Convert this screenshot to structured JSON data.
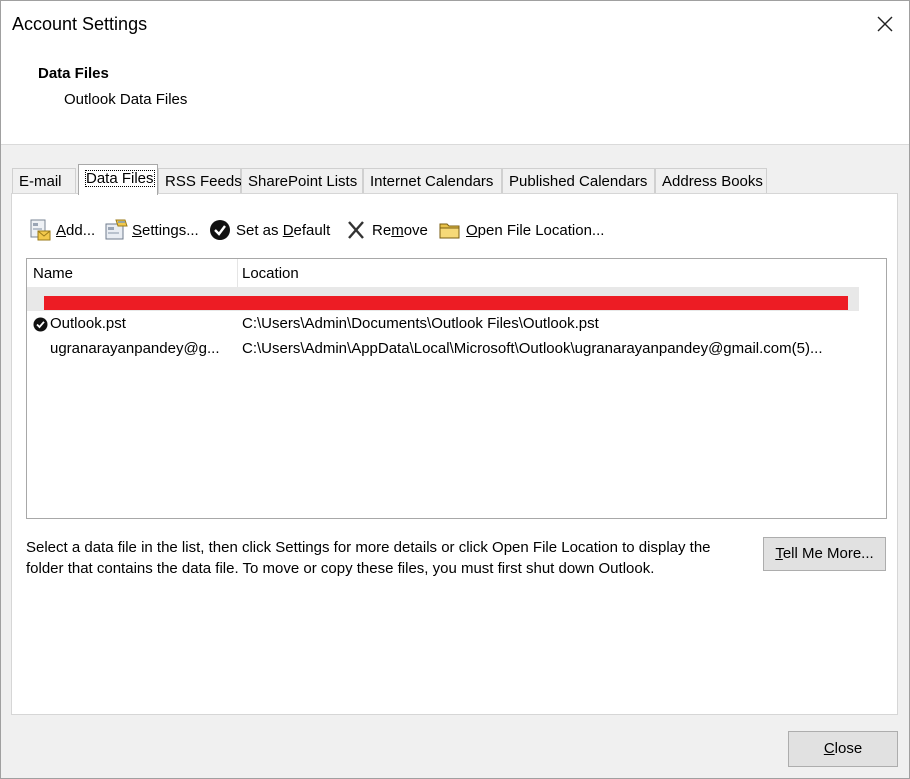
{
  "window": {
    "title": "Account Settings"
  },
  "header": {
    "heading": "Data Files",
    "subheading": "Outlook Data Files"
  },
  "tabs": [
    {
      "label": "E-mail"
    },
    {
      "label": "Data Files",
      "active": true
    },
    {
      "label": "RSS Feeds"
    },
    {
      "label": "SharePoint Lists"
    },
    {
      "label": "Internet Calendars"
    },
    {
      "label": "Published Calendars"
    },
    {
      "label": "Address Books"
    }
  ],
  "toolbar": {
    "add": {
      "pre": "",
      "key": "A",
      "post": "dd..."
    },
    "settings": {
      "pre": "",
      "key": "S",
      "post": "ettings..."
    },
    "set_default": {
      "pre": "Set as ",
      "key": "D",
      "post": "efault"
    },
    "remove": {
      "pre": "Re",
      "key": "m",
      "post": "ove"
    },
    "open_location": {
      "pre": "",
      "key": "O",
      "post": "pen File Location..."
    }
  },
  "list": {
    "columns": {
      "name": "Name",
      "location": "Location"
    },
    "rows": [
      {
        "name": "Outlook.pst",
        "location": "C:\\Users\\Admin\\Documents\\Outlook Files\\Outlook.pst",
        "default": true
      },
      {
        "name": "ugranarayanpandey@g...",
        "location": "C:\\Users\\Admin\\AppData\\Local\\Microsoft\\Outlook\\ugranarayanpandey@gmail.com(5)...",
        "default": false
      }
    ]
  },
  "description": "Select a data file in the list, then click Settings for more details or click Open File Location to display the folder that contains the data file. To move or copy these files, you must first shut down Outlook.",
  "buttons": {
    "tell_more": {
      "pre": "",
      "key": "T",
      "post": "ell Me More..."
    },
    "close": {
      "pre": "",
      "key": "C",
      "post": "lose"
    }
  },
  "colors": {
    "redaction": "#ed1c24",
    "window_bg": "#f0f0f0",
    "button_bg": "#e1e1e1"
  }
}
